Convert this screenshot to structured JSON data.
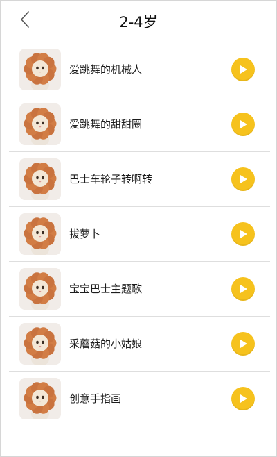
{
  "header": {
    "title": "2-4岁",
    "back_icon": "chevron-left-icon"
  },
  "colors": {
    "accent": "#f6c21d",
    "divider": "#dedede"
  },
  "songs": [
    {
      "title": "爱跳舞的机械人",
      "thumb_icon": "flower-cat-icon",
      "action_icon": "play-icon"
    },
    {
      "title": "爱跳舞的甜甜圈",
      "thumb_icon": "flower-cat-icon",
      "action_icon": "play-icon"
    },
    {
      "title": "巴士车轮子转啊转",
      "thumb_icon": "flower-cat-icon",
      "action_icon": "play-icon"
    },
    {
      "title": "拔萝卜",
      "thumb_icon": "flower-cat-icon",
      "action_icon": "play-icon"
    },
    {
      "title": "宝宝巴士主题歌",
      "thumb_icon": "flower-cat-icon",
      "action_icon": "play-icon"
    },
    {
      "title": "采蘑菇的小姑娘",
      "thumb_icon": "flower-cat-icon",
      "action_icon": "play-icon"
    },
    {
      "title": "创意手指画",
      "thumb_icon": "flower-cat-icon",
      "action_icon": "play-icon"
    }
  ]
}
